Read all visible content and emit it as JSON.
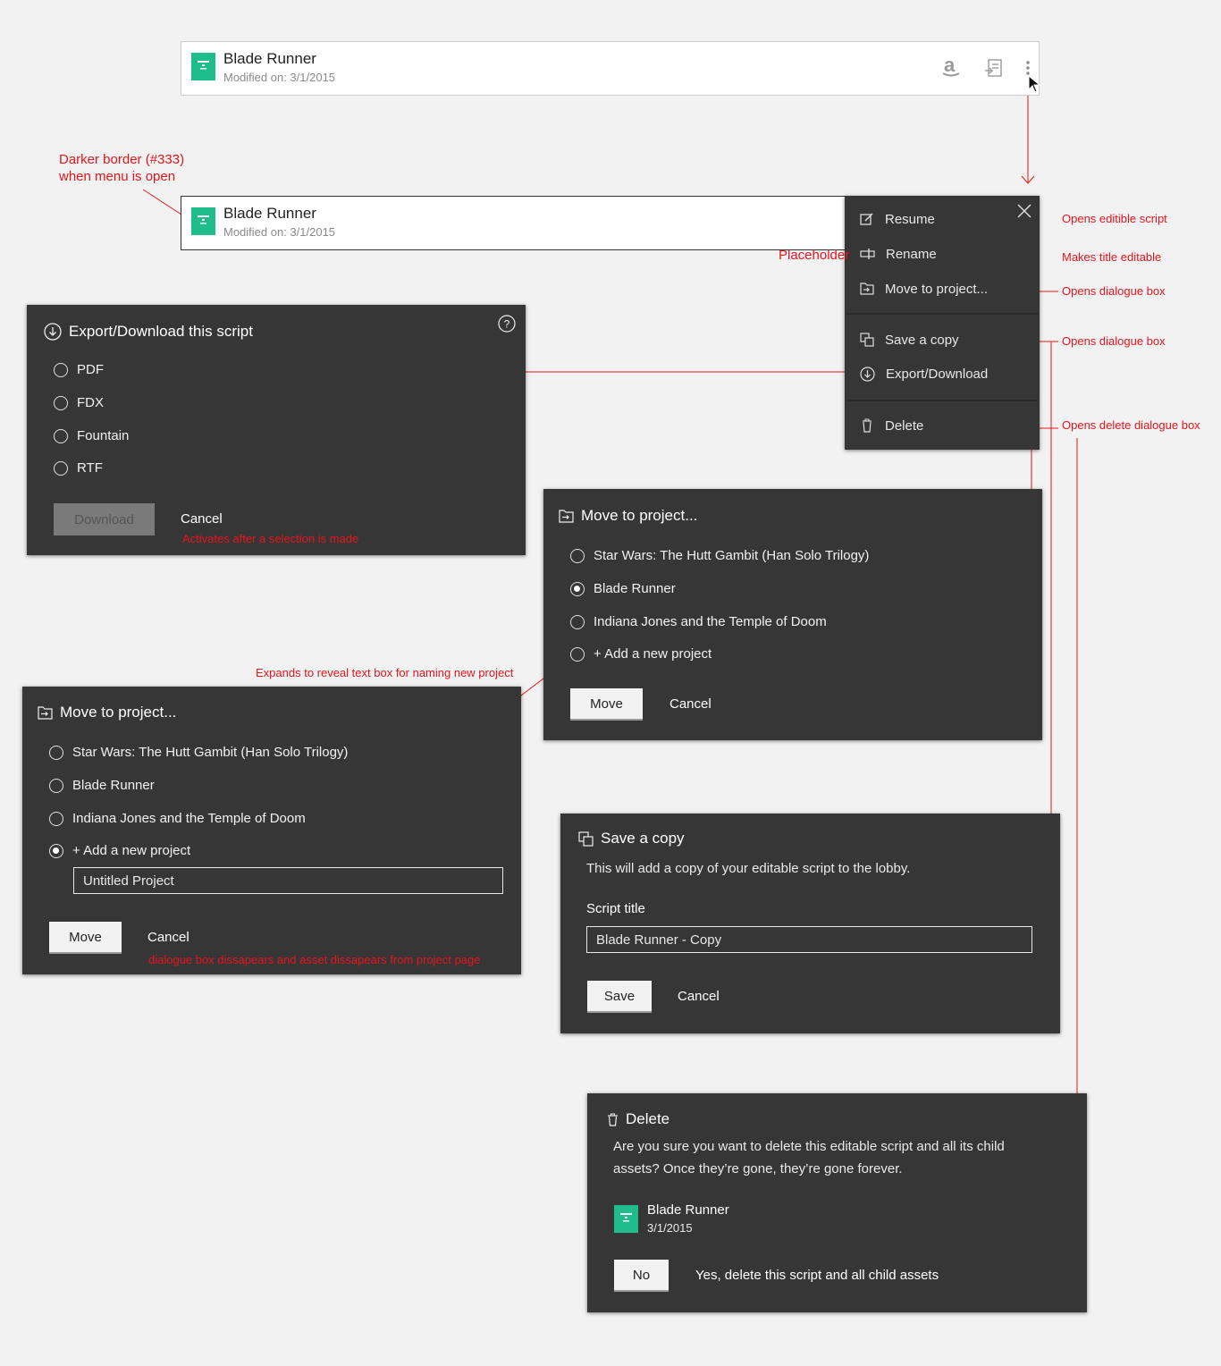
{
  "card_normal": {
    "title": "Blade Runner",
    "subtitle": "Modified on: 3/1/2015",
    "icons": [
      "script-icon",
      "amazon-icon",
      "export-icon",
      "more-vertical-icon"
    ]
  },
  "card_open": {
    "title": "Blade Runner",
    "subtitle": "Modified on: 3/1/2015"
  },
  "menu": {
    "items": [
      {
        "label": "Resume",
        "icon": "edit-icon"
      },
      {
        "label": "Rename",
        "icon": "rename-icon"
      },
      {
        "label": "Move to project...",
        "icon": "move-icon"
      },
      {
        "label": "Save a copy",
        "icon": "copy-icon"
      },
      {
        "label": "Export/Download",
        "icon": "download-icon"
      },
      {
        "label": "Delete",
        "icon": "trash-icon"
      }
    ]
  },
  "export_dialog": {
    "title": "Export/Download this script",
    "options": [
      "PDF",
      "FDX",
      "Fountain",
      "RTF"
    ],
    "download_label": "Download",
    "cancel_label": "Cancel"
  },
  "move_dialog": {
    "title": "Move to project...",
    "options": [
      "Star Wars: The Hutt Gambit (Han Solo Trilogy)",
      "Blade Runner",
      "Indiana Jones and the Temple of Doom",
      "+ Add a new project"
    ],
    "move_label": "Move",
    "cancel_label": "Cancel"
  },
  "move_dialog_expanded": {
    "title": "Move to project...",
    "options": [
      "Star Wars: The Hutt Gambit (Han Solo Trilogy)",
      "Blade Runner",
      "Indiana Jones and the Temple of Doom",
      "+ Add a new project"
    ],
    "new_project_value": "Untitled Project",
    "move_label": "Move",
    "cancel_label": "Cancel"
  },
  "copy_dialog": {
    "title": "Save a copy",
    "description": "This will add a copy of your editable script to the lobby.",
    "field_label": "Script title",
    "field_value": "Blade Runner - Copy",
    "save_label": "Save",
    "cancel_label": "Cancel"
  },
  "delete_dialog": {
    "title": "Delete",
    "description_line1": "Are you sure you want to delete this editable script and all its child",
    "description_line2": "assets? Once they’re gone, they’re gone forever.",
    "asset_title": "Blade Runner",
    "asset_date": "3/1/2015",
    "no_label": "No",
    "yes_label": "Yes, delete this script and all child assets"
  },
  "annotations": {
    "border_note_line1": "Darker border (#333)",
    "border_note_line2": "when menu is open",
    "placeholder": "Placeholder",
    "resume_note": "Opens editible script",
    "rename_note": "Makes title editable",
    "move_note": "Opens dialogue box",
    "copy_note": "Opens dialogue box",
    "delete_note": "Opens delete dialogue box",
    "download_note": "Activates after a selection is made",
    "expand_note": "Expands to reveal text box for naming new project",
    "move_result_note": "dialogue box dissapears and asset dissapears from project page"
  },
  "colors": {
    "accent": "#1fbd8b",
    "panel": "#363636",
    "annotation": "#e8141c"
  }
}
